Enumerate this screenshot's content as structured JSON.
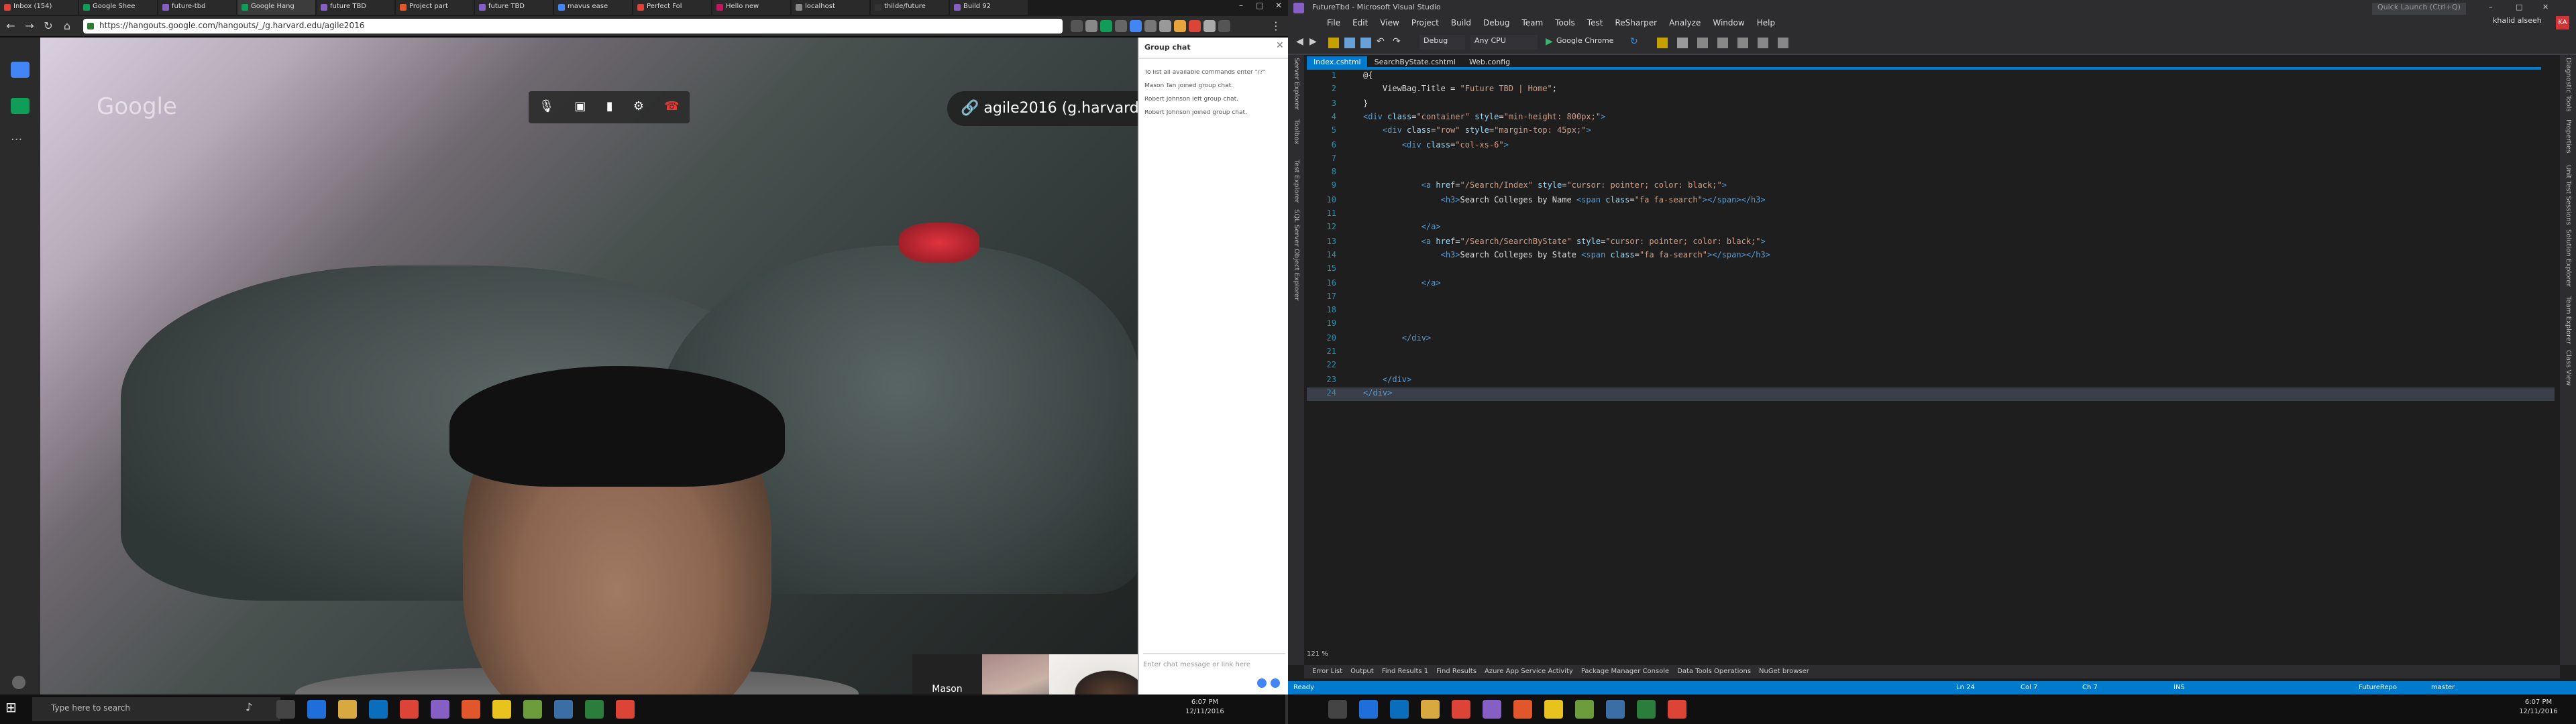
{
  "browser": {
    "tabs": [
      "Inbox (154)",
      "Google Shee",
      "future-tbd",
      "Google Hang",
      "future TBD",
      "Project part",
      "future TBD",
      "mavus ease",
      "Perfect Fol",
      "Hello new",
      "localhost",
      "thilde/future",
      "Build 92"
    ],
    "url": "https://hangouts.google.com/hangouts/_/g.harvard.edu/agile2016"
  },
  "hangouts": {
    "logo": "Google",
    "room_name": "agile2016 (g.harvard....",
    "participant": "Mason",
    "chat": {
      "title": "Group chat",
      "messages": [
        "To list all available commands enter \"/?\"",
        "Mason Tan joined group chat.",
        "Robert Johnson left group chat.",
        "Robert Johnson joined group chat."
      ],
      "placeholder": "Enter chat message or link here"
    }
  },
  "vs": {
    "title": "FutureTbd - Microsoft Visual Studio",
    "quick_launch": "Quick Launch (Ctrl+Q)",
    "user": "khalid alseeh",
    "menu": [
      "File",
      "Edit",
      "View",
      "Project",
      "Build",
      "Debug",
      "Team",
      "Tools",
      "Test",
      "ReSharper",
      "Analyze",
      "Window",
      "Help"
    ],
    "toolbar": {
      "config": "Debug",
      "platform": "Any CPU",
      "run": "Google Chrome"
    },
    "tabs": [
      "Index.cshtml",
      "SearchByState.cshtml",
      "Web.config"
    ],
    "left_panels": [
      "Server Explorer",
      "Toolbox",
      "Test Explorer",
      "SQL Server Object Explorer"
    ],
    "right_panels": [
      "Diagnostic Tools",
      "Properties",
      "Unit Test Sessions",
      "Solution Explorer",
      "Team Explorer",
      "Class View"
    ],
    "code": [
      {
        "n": "1",
        "s": [
          {
            "c": "r",
            "t": "@{"
          }
        ]
      },
      {
        "n": "2",
        "s": [
          {
            "c": "r",
            "t": "    ViewBag.Title = "
          },
          {
            "c": "s",
            "t": "\"Future TBD | Home\""
          },
          {
            "c": "r",
            "t": ";"
          }
        ]
      },
      {
        "n": "3",
        "s": [
          {
            "c": "r",
            "t": "}"
          }
        ]
      },
      {
        "n": "4",
        "s": [
          {
            "c": "t",
            "t": "<div "
          },
          {
            "c": "a",
            "t": "class"
          },
          {
            "c": "r",
            "t": "="
          },
          {
            "c": "s",
            "t": "\"container\" "
          },
          {
            "c": "a",
            "t": "style"
          },
          {
            "c": "r",
            "t": "="
          },
          {
            "c": "s",
            "t": "\"min-height: 800px;\""
          },
          {
            "c": "t",
            "t": ">"
          }
        ]
      },
      {
        "n": "5",
        "s": [
          {
            "c": "t",
            "t": "    <div "
          },
          {
            "c": "a",
            "t": "class"
          },
          {
            "c": "r",
            "t": "="
          },
          {
            "c": "s",
            "t": "\"row\" "
          },
          {
            "c": "a",
            "t": "style"
          },
          {
            "c": "r",
            "t": "="
          },
          {
            "c": "s",
            "t": "\"margin-top: 45px;\""
          },
          {
            "c": "t",
            "t": ">"
          }
        ]
      },
      {
        "n": "6",
        "s": [
          {
            "c": "t",
            "t": "        <div "
          },
          {
            "c": "a",
            "t": "class"
          },
          {
            "c": "r",
            "t": "="
          },
          {
            "c": "s",
            "t": "\"col-xs-6\""
          },
          {
            "c": "t",
            "t": ">"
          }
        ]
      },
      {
        "n": "7",
        "s": []
      },
      {
        "n": "8",
        "s": []
      },
      {
        "n": "9",
        "s": [
          {
            "c": "t",
            "t": "            <a "
          },
          {
            "c": "a",
            "t": "href"
          },
          {
            "c": "r",
            "t": "="
          },
          {
            "c": "s",
            "t": "\"/Search/Index\" "
          },
          {
            "c": "a",
            "t": "style"
          },
          {
            "c": "r",
            "t": "="
          },
          {
            "c": "s",
            "t": "\"cursor: pointer; color: black;\""
          },
          {
            "c": "t",
            "t": ">"
          }
        ]
      },
      {
        "n": "10",
        "s": [
          {
            "c": "t",
            "t": "                <h3>"
          },
          {
            "c": "r",
            "t": "Search Colleges by Name "
          },
          {
            "c": "t",
            "t": "<span "
          },
          {
            "c": "a",
            "t": "class"
          },
          {
            "c": "r",
            "t": "="
          },
          {
            "c": "s",
            "t": "\"fa fa-search\""
          },
          {
            "c": "t",
            "t": "></span></h3>"
          }
        ]
      },
      {
        "n": "11",
        "s": []
      },
      {
        "n": "12",
        "s": [
          {
            "c": "t",
            "t": "            </a>"
          }
        ]
      },
      {
        "n": "13",
        "s": [
          {
            "c": "t",
            "t": "            <a "
          },
          {
            "c": "a",
            "t": "href"
          },
          {
            "c": "r",
            "t": "="
          },
          {
            "c": "s",
            "t": "\"/Search/SearchByState\" "
          },
          {
            "c": "a",
            "t": "style"
          },
          {
            "c": "r",
            "t": "="
          },
          {
            "c": "s",
            "t": "\"cursor: pointer; color: black;\""
          },
          {
            "c": "t",
            "t": ">"
          }
        ]
      },
      {
        "n": "14",
        "s": [
          {
            "c": "t",
            "t": "                <h3>"
          },
          {
            "c": "r",
            "t": "Search Colleges by State "
          },
          {
            "c": "t",
            "t": "<span "
          },
          {
            "c": "a",
            "t": "class"
          },
          {
            "c": "r",
            "t": "="
          },
          {
            "c": "s",
            "t": "\"fa fa-search\""
          },
          {
            "c": "t",
            "t": "></span></h3>"
          }
        ]
      },
      {
        "n": "15",
        "s": []
      },
      {
        "n": "16",
        "s": [
          {
            "c": "t",
            "t": "            </a>"
          }
        ]
      },
      {
        "n": "17",
        "s": []
      },
      {
        "n": "18",
        "s": []
      },
      {
        "n": "19",
        "s": []
      },
      {
        "n": "20",
        "s": [
          {
            "c": "t",
            "t": "        </div>"
          }
        ]
      },
      {
        "n": "21",
        "s": []
      },
      {
        "n": "22",
        "s": []
      },
      {
        "n": "23",
        "s": [
          {
            "c": "t",
            "t": "    </div>"
          }
        ]
      },
      {
        "n": "24",
        "s": [
          {
            "c": "t",
            "t": "</div>"
          }
        ]
      }
    ],
    "zoom": "121 %",
    "bottom_tabs": [
      "Error List",
      "Output",
      "Find Results 1",
      "Find Results",
      "Azure App Service Activity",
      "Package Manager Console",
      "Data Tools Operations",
      "NuGet browser"
    ],
    "status": {
      "ready": "Ready",
      "ln": "Ln 24",
      "col": "Col 7",
      "ch": "Ch 7",
      "ins": "INS",
      "repo": "FutureRepo",
      "branch": "master"
    }
  },
  "taskbar": {
    "search": "Type here to search",
    "time_left": "6:07 PM",
    "date_left": "12/11/2016",
    "time_right": "6:07 PM",
    "date_right": "12/11/2016"
  },
  "colors": {
    "accent": "#007acc",
    "hangouts_green": "#0f9d58"
  }
}
